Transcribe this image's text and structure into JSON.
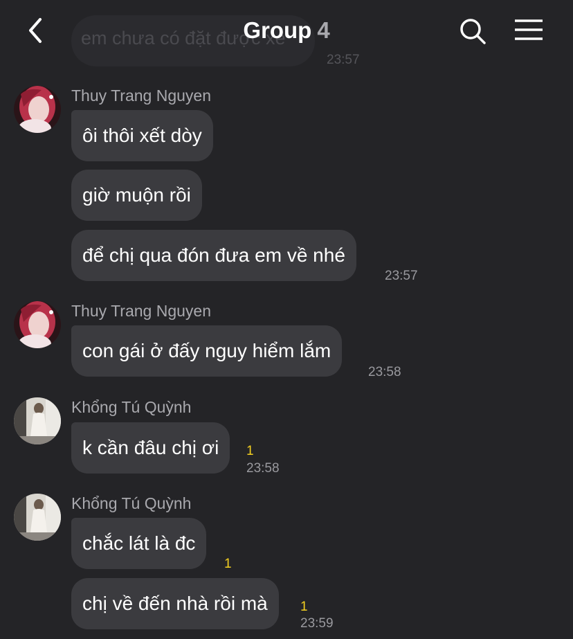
{
  "header": {
    "title": "Group",
    "member_count": "4",
    "back_icon": "chevron-left-icon",
    "search_icon": "search-icon",
    "menu_icon": "hamburger-menu-icon"
  },
  "previous": {
    "text": "em chưa có đặt được xe",
    "time": "23:57"
  },
  "groups": [
    {
      "sender": "Thuy Trang Nguyen",
      "messages": [
        {
          "text": "ôi thôi xết dòy"
        },
        {
          "text": "giờ muộn rồi"
        },
        {
          "text": "để chị qua đón đưa em về nhé",
          "time": "23:57"
        }
      ]
    },
    {
      "sender": "Thuy Trang Nguyen",
      "messages": [
        {
          "text": "con gái ở đấy nguy hiểm lắm",
          "time": "23:58"
        }
      ]
    },
    {
      "sender": "Khổng Tú Quỳnh",
      "messages": [
        {
          "text": "k cần đâu chị ơi",
          "unread": "1",
          "time": "23:58"
        }
      ]
    },
    {
      "sender": "Khổng Tú Quỳnh",
      "messages": [
        {
          "text": "chắc lát là đc",
          "unread": "1"
        },
        {
          "text": "chị về đến nhà rồi mà",
          "unread": "1",
          "time": "23:59"
        }
      ]
    }
  ],
  "colors": {
    "background": "#242427",
    "bubble": "#3b3b3f",
    "unread": "#f5d020",
    "muted_text": "#a9a9ae"
  }
}
